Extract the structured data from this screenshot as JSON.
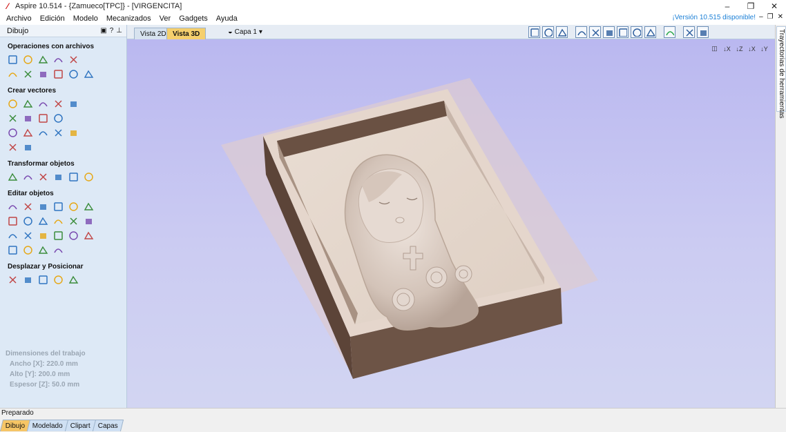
{
  "window": {
    "title": "Aspire 10.514 - {Zamueco[TPC]} - [VIRGENCITA]",
    "controls": [
      "–",
      "❐",
      "✕"
    ]
  },
  "menu": {
    "items": [
      "Archivo",
      "Edición",
      "Modelo",
      "Mecanizados",
      "Ver",
      "Gadgets",
      "Ayuda"
    ],
    "update_notice": "¡Versión 10.515 disponible!"
  },
  "left_panel": {
    "header": "Dibujo",
    "sections": [
      {
        "title": "Operaciones con archivos",
        "rows": [
          [
            "new-file",
            "open-folder",
            "save",
            "open-job",
            "import"
          ],
          [
            "select-all",
            "cut",
            "copy",
            "paste",
            "undo",
            "redo"
          ]
        ]
      },
      {
        "title": "Crear vectores",
        "rows": [
          [
            "circle",
            "ellipse",
            "rectangle",
            "polygon",
            "star"
          ],
          [
            "polyline",
            "arc",
            "curve",
            "spiral"
          ],
          [
            "text",
            "text-box",
            "text-on-curve",
            "dimension",
            "table"
          ],
          [
            "fillet",
            "measure"
          ]
        ]
      },
      {
        "title": "Transformar objetos",
        "rows": [
          [
            "move",
            "scale",
            "align",
            "mirror",
            "distort",
            "center"
          ]
        ]
      },
      {
        "title": "Editar objetos",
        "rows": [
          [
            "select-pointer",
            "node-edit",
            "node-add",
            "group",
            "ungroup",
            "trim"
          ],
          [
            "weld",
            "subtract",
            "offset",
            "join",
            "scissors",
            "knife"
          ],
          [
            "angle",
            "v-shape",
            "smooth",
            "arrows",
            "trim-edge",
            "image"
          ],
          [
            "rounded-rect",
            "bracket-1",
            "bracket-2",
            "bracket-3"
          ]
        ]
      },
      {
        "title": "Desplazar y Posicionar",
        "rows": [
          [
            "nest",
            "array",
            "copy-along",
            "path-offset",
            "block-array"
          ]
        ]
      }
    ],
    "dimensions": {
      "title": "Dimensiones del trabajo",
      "width": "Ancho   [X]: 220.0 mm",
      "height": "Alto    [Y]: 200.0 mm",
      "thickness": "Espesor [Z]: 50.0 mm"
    },
    "bottom_tabs": [
      "Dibujo",
      "Modelado",
      "Clipart",
      "Capas"
    ],
    "active_bottom_tab": "Dibujo"
  },
  "view": {
    "tabs": [
      "Vista 2D",
      "Vista 3D"
    ],
    "active_tab": "Vista 3D",
    "layer_selector": "Capa 1"
  },
  "toolbar_icons": [
    "zoom-extents",
    "zoom-window",
    "grid",
    "snap",
    "zoom-in",
    "zoom-out",
    "zoom-fit",
    "rotate",
    "pan",
    "render",
    "layout-1",
    "layout-2"
  ],
  "view_orientation_icons": [
    "iso-view",
    "axis-x",
    "axis-z",
    "axis-x2",
    "axis-y"
  ],
  "right_panel": {
    "tab": "Trayectorias de herramientas"
  },
  "status": {
    "text": "Preparado"
  },
  "colors": {
    "viewport_top": "#bab8f0",
    "viewport_bottom": "#d2d5f2",
    "active_tab": "#f5cf6d",
    "panel_bg": "#dde9f6",
    "wood_top": "#e6d6cb",
    "wood_side": "#6a5243"
  }
}
